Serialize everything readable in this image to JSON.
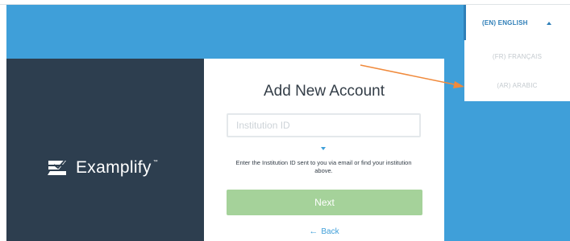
{
  "brand": {
    "name": "Examplify",
    "trademark": "™"
  },
  "card": {
    "title": "Add New Account",
    "institution_placeholder": "Institution ID",
    "institution_value": "",
    "help_text": "Enter the Institution ID sent to you via email or find your institution above.",
    "next_label": "Next",
    "back_label": "Back"
  },
  "language": {
    "current": "(EN) ENGLISH",
    "options": [
      "(FR) FRANÇAIS",
      "(AR) ARABIC"
    ]
  },
  "colors": {
    "background_blue": "#3f9fd9",
    "brand_panel": "#2d3e4f",
    "next_button": "#a5d29a",
    "accent": "#2f7fb8",
    "annotation_arrow": "#f08a3c"
  },
  "icons": {
    "logo": "examplify-logo-icon",
    "caret_down": "chevron-down-icon",
    "caret_up": "chevron-up-icon",
    "back": "arrow-left-icon"
  }
}
